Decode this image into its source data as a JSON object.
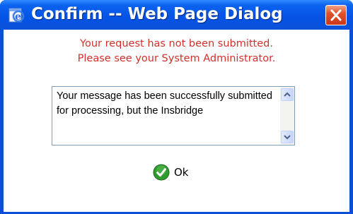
{
  "window": {
    "title": "Confirm -- Web Page Dialog",
    "title_icon": "ie-page-icon",
    "close_icon": "close-icon"
  },
  "dialog": {
    "error_line_1": "Your request has not been submitted.",
    "error_line_2": "Please see your System Administrator.",
    "message_text": "Your message has been successfully submitted for processing, but the Insbridge",
    "ok_label": "Ok",
    "ok_icon": "check-icon"
  },
  "colors": {
    "title_bar": "#0553e6",
    "error_text": "#d4302a",
    "close_button": "#e0522c",
    "ok_icon": "#2f9a2f"
  }
}
